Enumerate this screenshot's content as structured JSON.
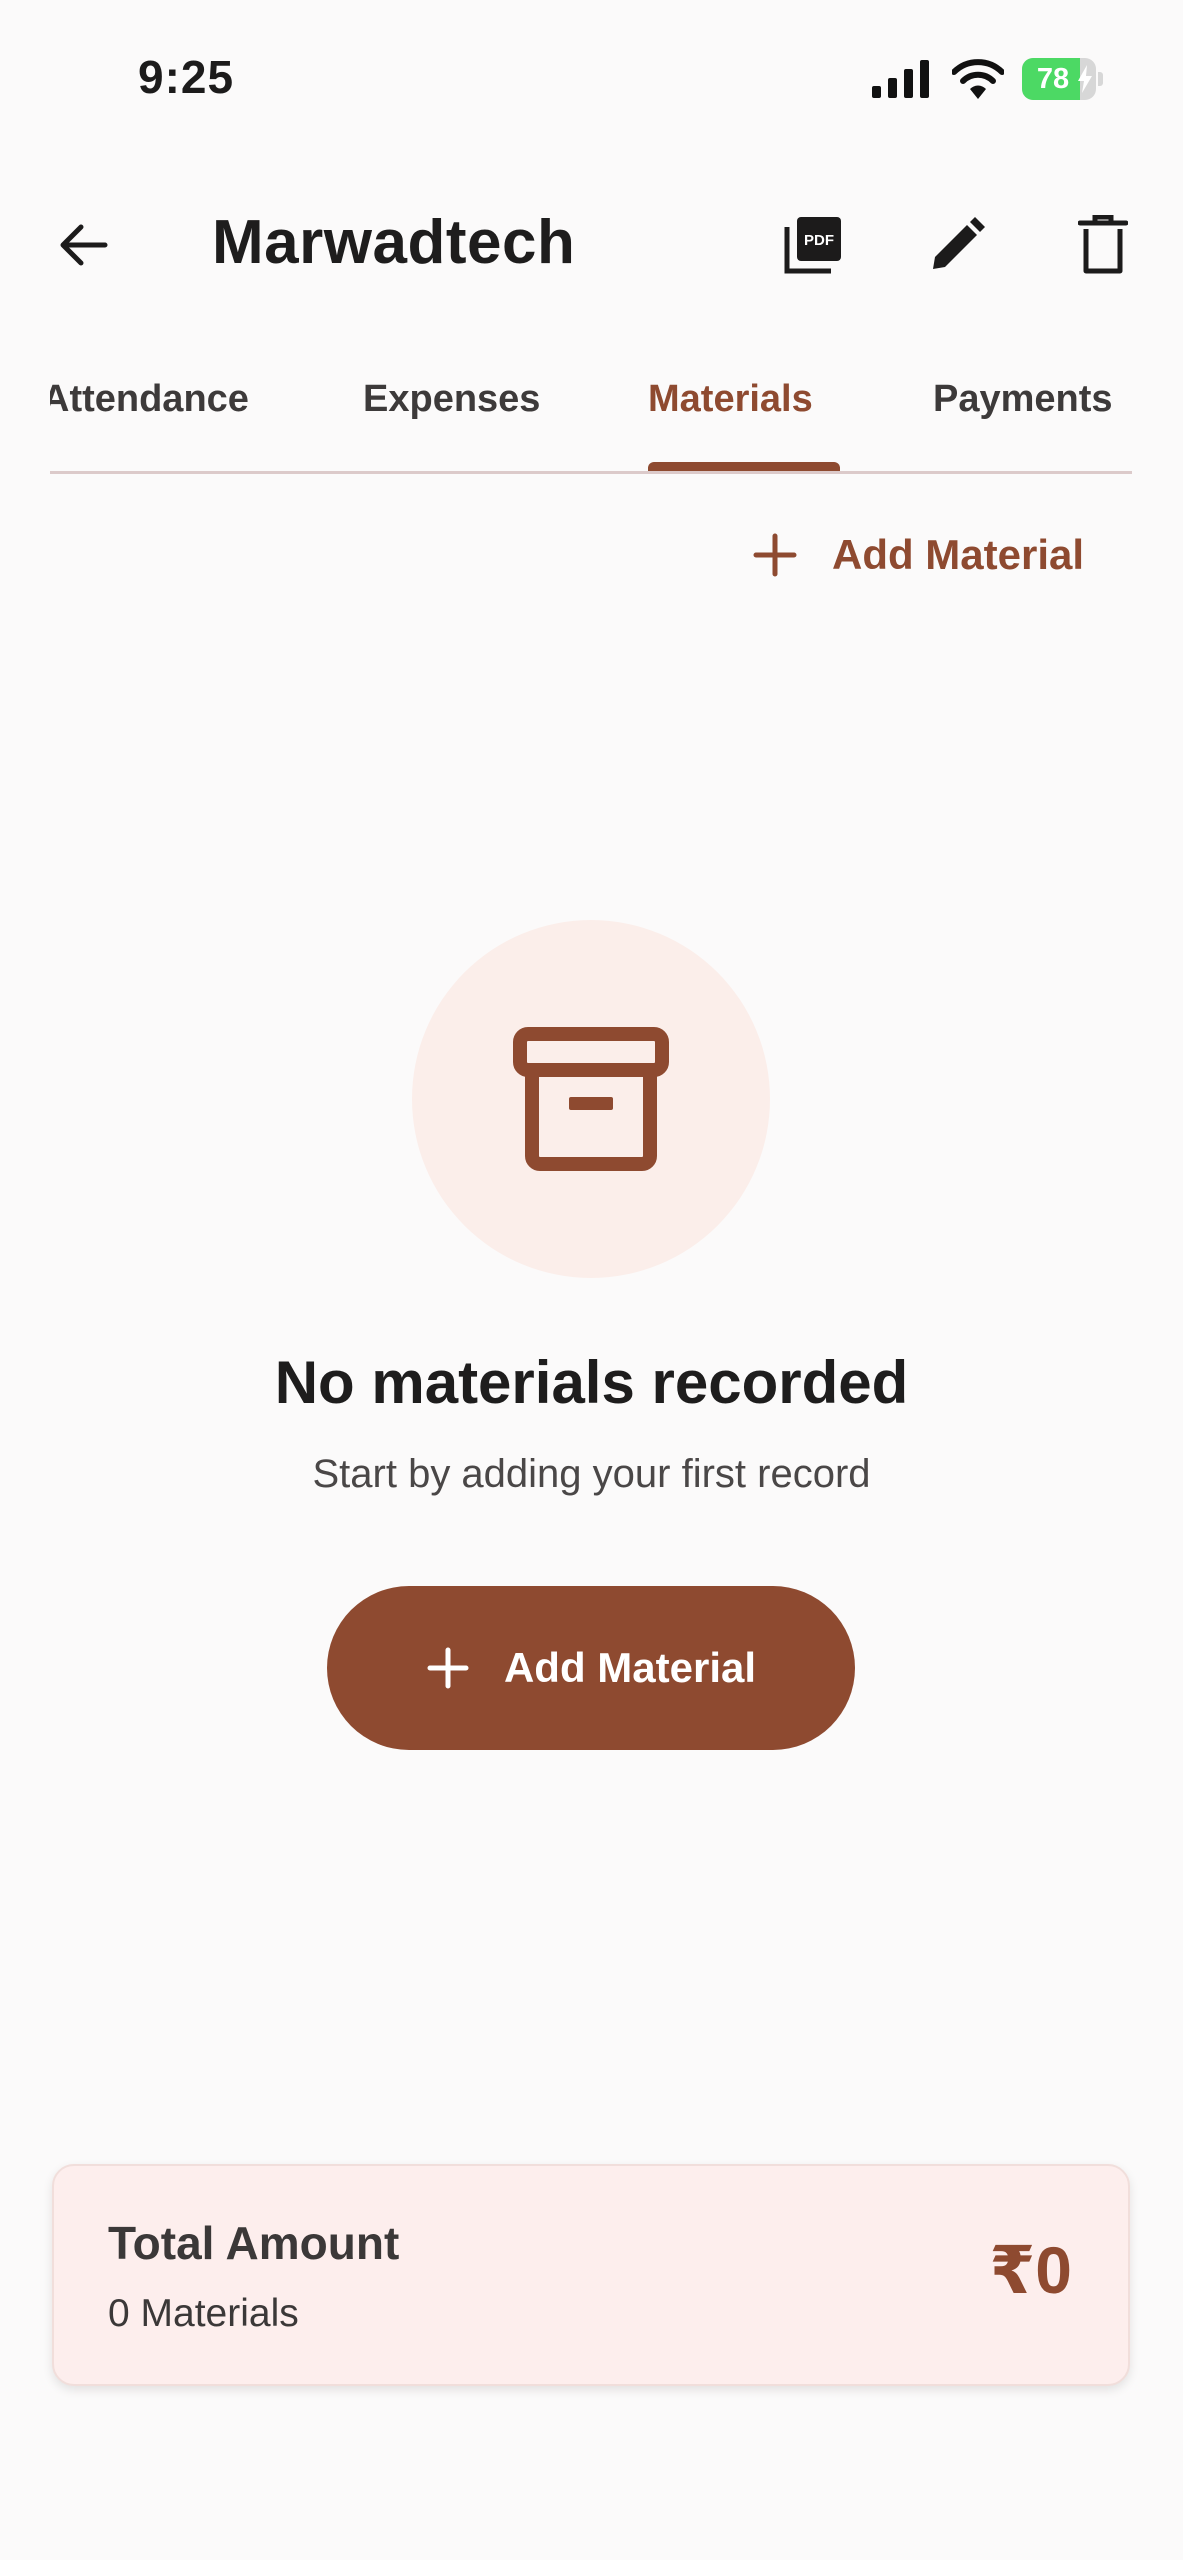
{
  "status_bar": {
    "time": "9:25",
    "battery_percent": "78",
    "battery_level": 0.78,
    "icons": [
      "signal-icon",
      "wifi-icon",
      "battery-icon"
    ]
  },
  "app_bar": {
    "title": "Marwadtech",
    "icons": [
      "back-arrow-icon",
      "pdf-icon",
      "edit-pencil-icon",
      "delete-trash-icon"
    ]
  },
  "tabs": [
    {
      "label": "Attendance",
      "active": false
    },
    {
      "label": "Expenses",
      "active": false
    },
    {
      "label": "Materials",
      "active": true
    },
    {
      "label": "Payments",
      "active": false
    }
  ],
  "top_action": {
    "label": "Add Material",
    "icon": "plus-icon"
  },
  "empty_state": {
    "icon": "archive-box-icon",
    "title": "No materials recorded",
    "subtitle": "Start by adding your first record",
    "button_label": "Add Material"
  },
  "summary": {
    "label": "Total Amount",
    "count": "0 Materials",
    "amount": "₹0"
  },
  "colors": {
    "accent": "#8e4a30",
    "accent_light": "#fbeeea",
    "card_bg": "#fdeeed",
    "battery_green": "#4cd964",
    "background": "#fbfafa"
  }
}
